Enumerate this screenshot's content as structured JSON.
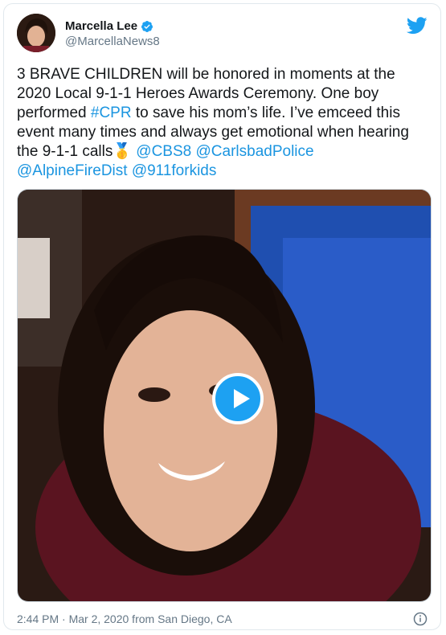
{
  "user": {
    "display_name": "Marcella Lee",
    "handle": "@MarcellaNews8",
    "verified": true
  },
  "tweet": {
    "text_parts": [
      {
        "type": "text",
        "value": "3 BRAVE CHILDREN will be honored in moments at the 2020 Local 9-1-1 Heroes Awards Ceremony. One boy performed "
      },
      {
        "type": "link",
        "value": "#CPR"
      },
      {
        "type": "text",
        "value": " to save his mom’s life. I’ve emceed this event many times and always get emotional when hearing the 9-1-1 calls"
      },
      {
        "type": "emoji",
        "value": "🥇"
      },
      {
        "type": "text",
        "value": " "
      },
      {
        "type": "link",
        "value": "@CBS8"
      },
      {
        "type": "text",
        "value": " "
      },
      {
        "type": "link",
        "value": "@CarlsbadPolice"
      },
      {
        "type": "text",
        "value": " "
      },
      {
        "type": "link",
        "value": "@AlpineFireDist"
      },
      {
        "type": "text",
        "value": " "
      },
      {
        "type": "link",
        "value": "@911forkids"
      }
    ],
    "media": {
      "kind": "video",
      "play_icon": "play-icon"
    },
    "timestamp": "2:44 PM · Mar 2, 2020 from San Diego, CA"
  },
  "icons": {
    "brand": "twitter-bird-icon",
    "verified": "verified-badge-icon",
    "info": "info-icon"
  },
  "colors": {
    "link": "#1b95e0",
    "brand": "#1da1f2",
    "muted": "#657786"
  }
}
